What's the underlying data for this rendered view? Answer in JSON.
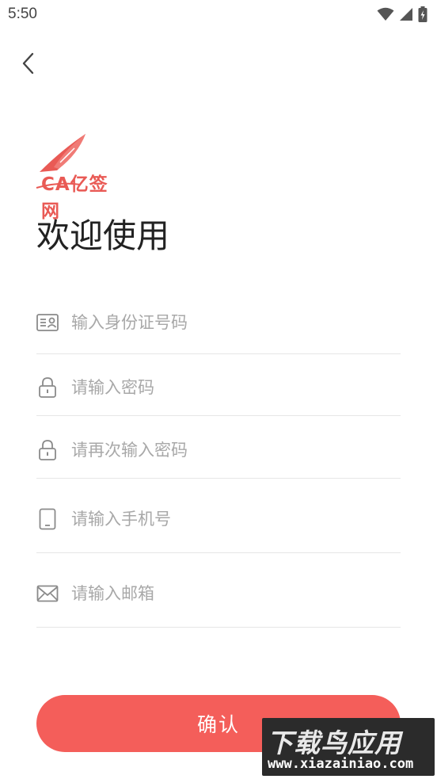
{
  "status_bar": {
    "time": "5:50",
    "icons": [
      "wifi-icon",
      "signal-icon",
      "battery-icon"
    ]
  },
  "header": {
    "back_icon": "chevron-left-icon"
  },
  "logo": {
    "text": "CA亿签网",
    "brand_color": "#e95a55"
  },
  "page": {
    "title": "欢迎使用"
  },
  "form": {
    "fields": [
      {
        "icon": "id-card-icon",
        "placeholder": "输入身份证号码",
        "value": ""
      },
      {
        "icon": "lock-icon",
        "placeholder": "请输入密码",
        "value": ""
      },
      {
        "icon": "lock-icon",
        "placeholder": "请再次输入密码",
        "value": ""
      },
      {
        "icon": "phone-icon",
        "placeholder": "请输入手机号",
        "value": ""
      },
      {
        "icon": "mail-icon",
        "placeholder": "请输入邮箱",
        "value": ""
      }
    ],
    "submit_label": "确认",
    "accent_color": "#f45e5a"
  },
  "watermark": {
    "title": "下载鸟应用",
    "url": "www.xiazainiao.com"
  }
}
